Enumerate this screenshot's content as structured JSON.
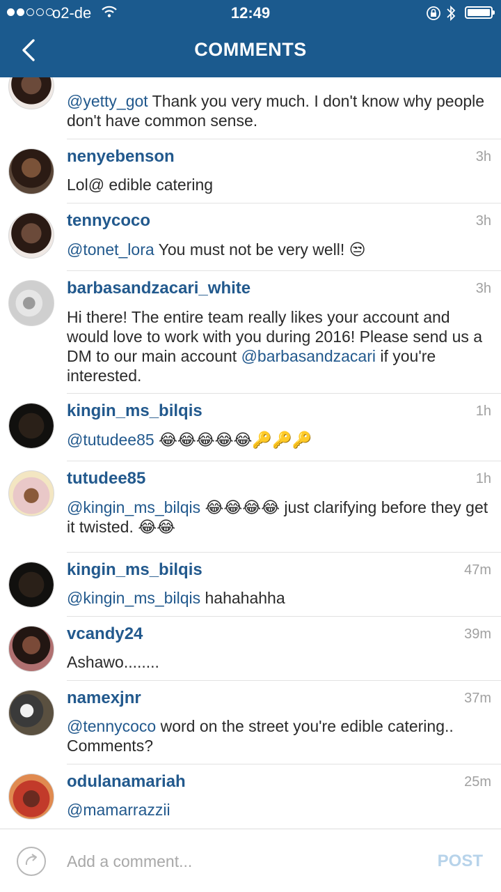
{
  "status_bar": {
    "carrier": "o2-de",
    "time": "12:49"
  },
  "header": {
    "title": "COMMENTS"
  },
  "comments": [
    {
      "username": "",
      "time": "",
      "mention": "@yetty_got",
      "text": " Thank you very much. I don't know why people don't have common sense."
    },
    {
      "username": "nenyebenson",
      "time": "3h",
      "mention": "",
      "text": "Lol@ edible catering"
    },
    {
      "username": "tennycoco",
      "time": "3h",
      "mention": "@tonet_lora",
      "text": " You must not be very well! 😒"
    },
    {
      "username": "barbasandzacari_white",
      "time": "3h",
      "text_before": "Hi there! The entire team really likes your account and would love to work with you during 2016! Please send us a DM to our main account ",
      "mention": "@barbasandzacari",
      "text_after": " if you're interested."
    },
    {
      "username": "kingin_ms_bilqis",
      "time": "1h",
      "mention": "@tutudee85",
      "text": " 😂😂😂😂😂🔑🔑🔑"
    },
    {
      "username": "tutudee85",
      "time": "1h",
      "mention": "@kingin_ms_bilqis",
      "text": " 😂😂😂😂 just clarifying before they get it twisted. 😂😂"
    },
    {
      "username": "kingin_ms_bilqis",
      "time": "47m",
      "mention": "@kingin_ms_bilqis",
      "text": " hahahahha"
    },
    {
      "username": "vcandy24",
      "time": "39m",
      "mention": "",
      "text": "Ashawo........"
    },
    {
      "username": "namexjnr",
      "time": "37m",
      "mention": "@tennycoco",
      "text": " word on the street you're edible catering.. Comments?"
    },
    {
      "username": "odulanamariah",
      "time": "25m",
      "mention": "@mamarrazzii",
      "text": ""
    }
  ],
  "footer": {
    "placeholder": "Add a comment...",
    "post_label": "POST"
  },
  "colors": {
    "header_bg": "#1b5a8e",
    "link": "#22598d",
    "post_disabled": "#b7d3ea"
  }
}
